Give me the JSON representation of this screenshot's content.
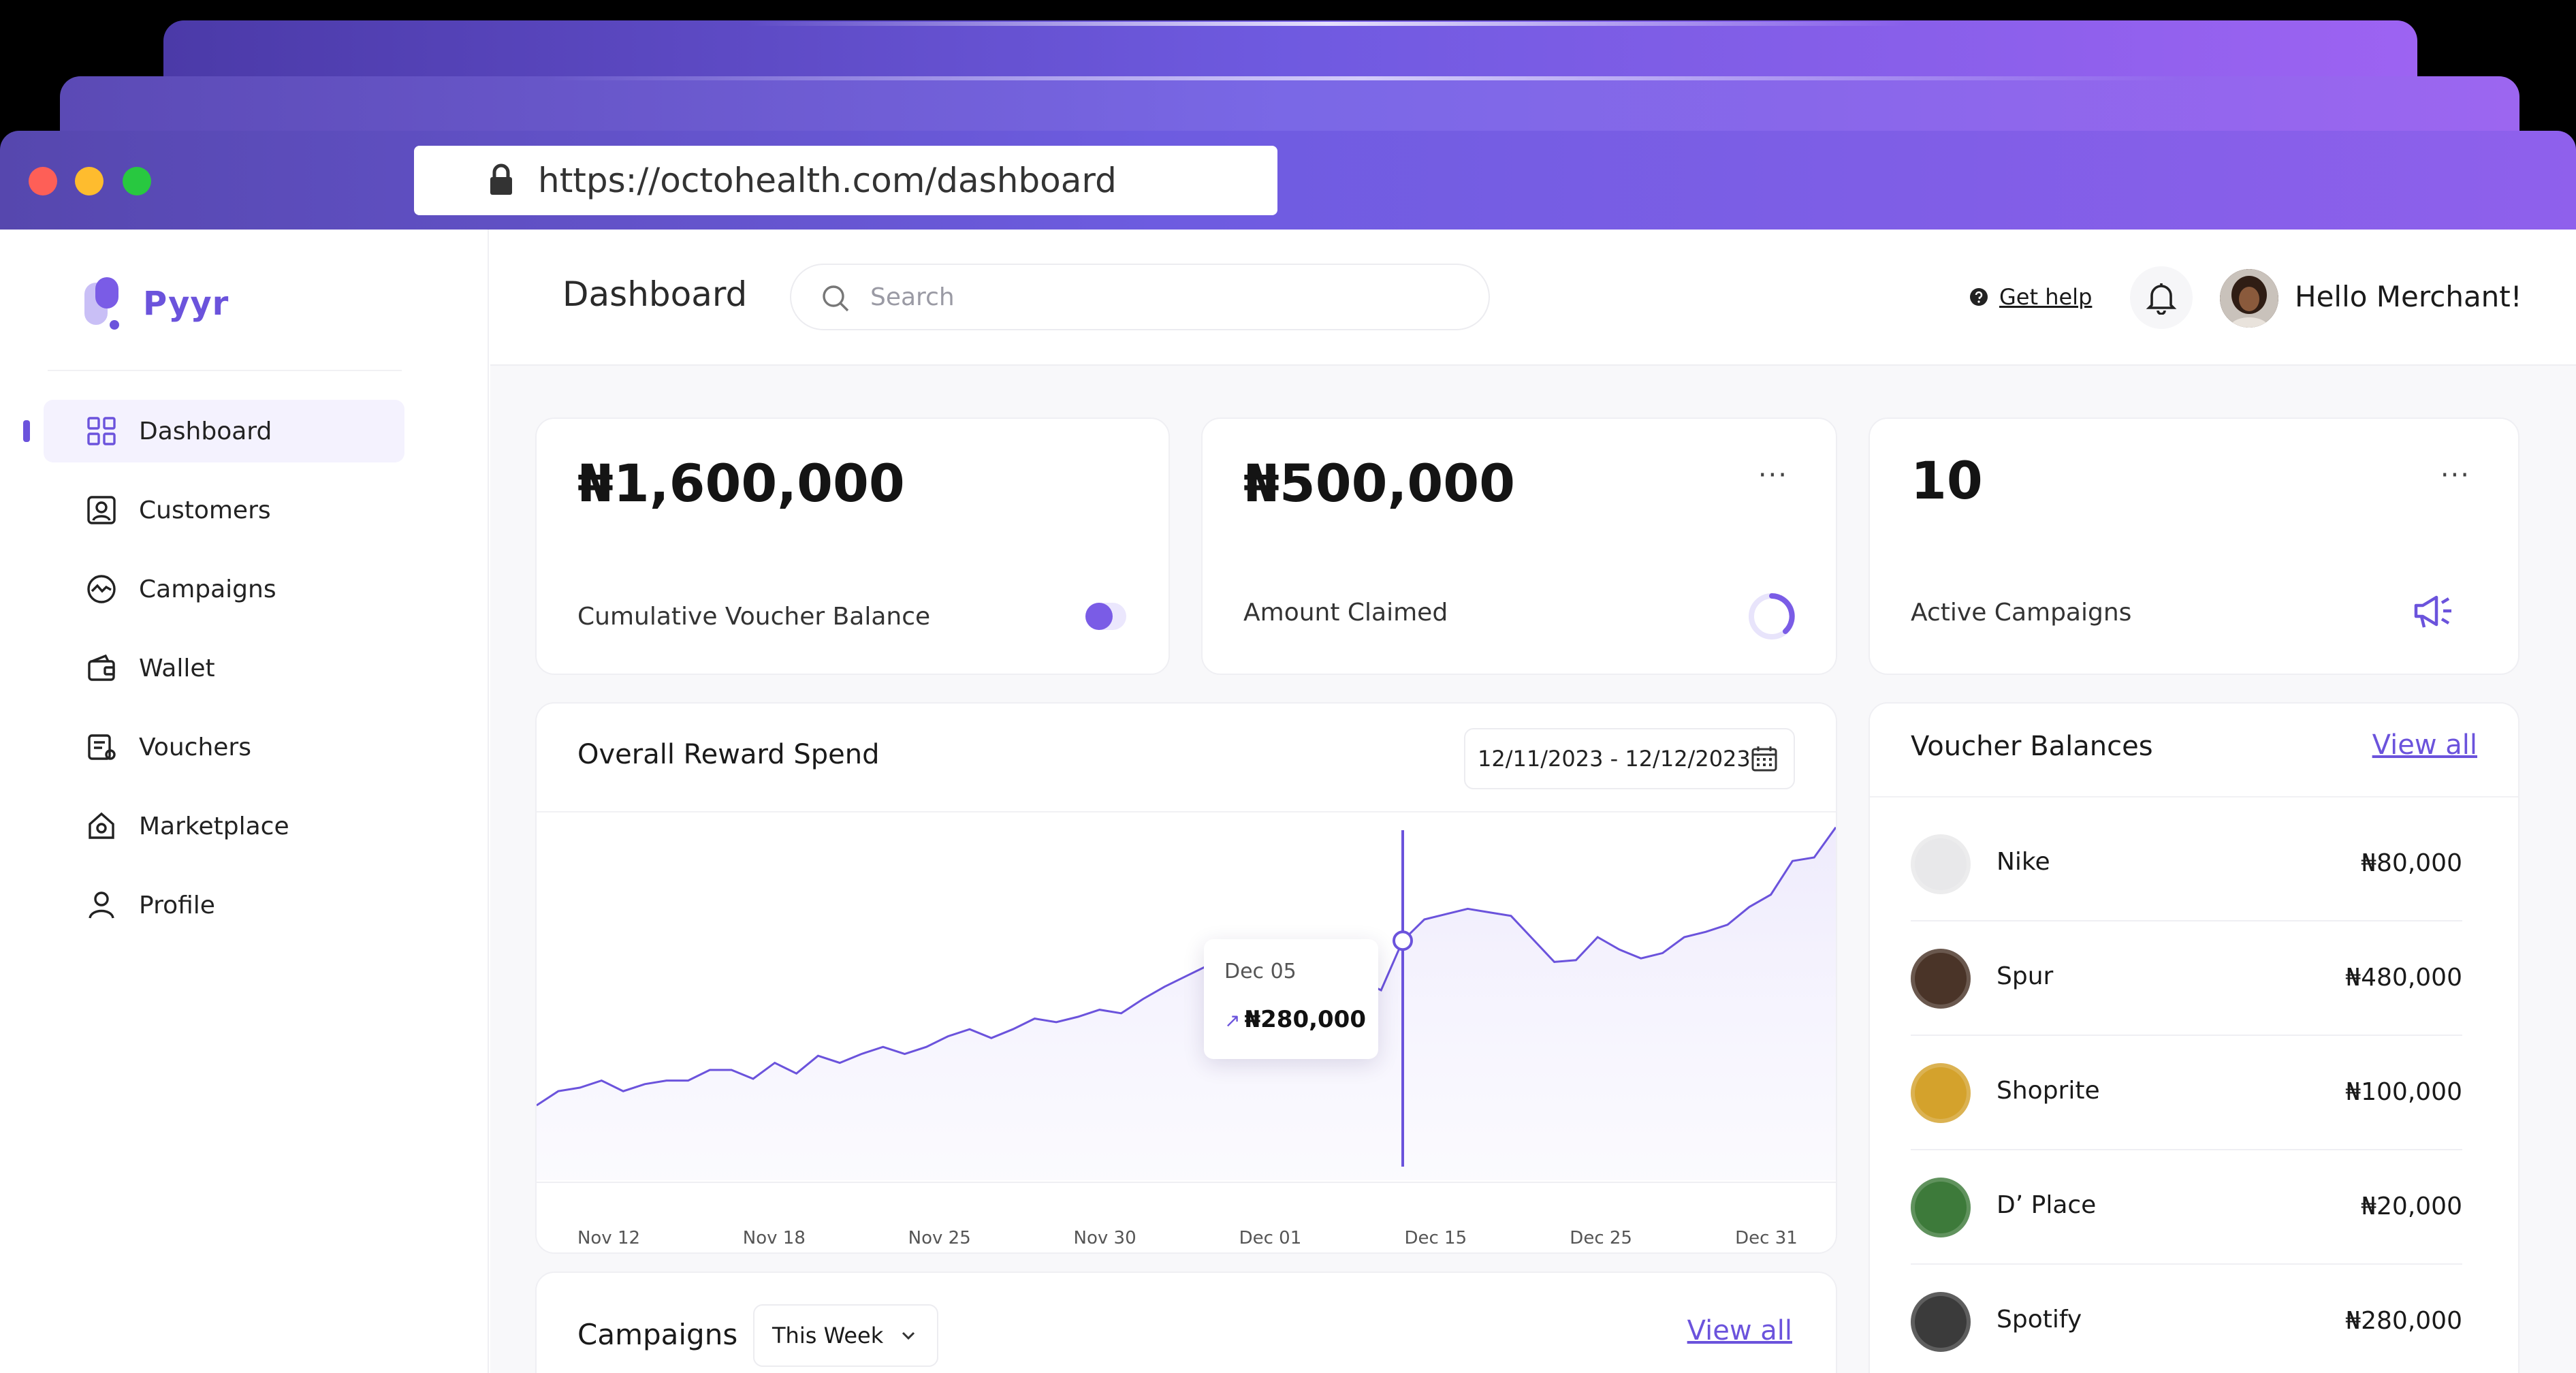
{
  "browser": {
    "url": "https://octohealth.com/dashboard"
  },
  "sidebar": {
    "brand": "Pyyr",
    "items": [
      {
        "label": "Dashboard",
        "icon": "grid-icon",
        "active": true
      },
      {
        "label": "Customers",
        "icon": "user-card-icon"
      },
      {
        "label": "Campaigns",
        "icon": "activity-icon"
      },
      {
        "label": "Wallet",
        "icon": "wallet-icon"
      },
      {
        "label": "Vouchers",
        "icon": "voucher-icon"
      },
      {
        "label": "Marketplace",
        "icon": "store-icon"
      },
      {
        "label": "Profile",
        "icon": "person-icon"
      }
    ]
  },
  "header": {
    "title": "Dashboard",
    "search_placeholder": "Search",
    "help_label": "Get help",
    "greeting": "Hello Merchant!"
  },
  "stats": [
    {
      "value": "₦1,600,000",
      "label": "Cumulative Voucher Balance"
    },
    {
      "value": "₦500,000",
      "label": "Amount Claimed"
    },
    {
      "value": "10",
      "label": "Active Campaigns"
    }
  ],
  "reward_chart": {
    "title": "Overall Reward Spend",
    "date_range": "12/11/2023 - 12/12/2023",
    "tooltip": {
      "date": "Dec 05",
      "value": "₦280,000"
    }
  },
  "chart_data": {
    "type": "area",
    "title": "Overall Reward Spend",
    "x_ticks": [
      "Nov 12",
      "Nov 18",
      "Nov 25",
      "Nov 30",
      "Dec 01",
      "Dec 15",
      "Dec 25",
      "Dec 31"
    ],
    "y_values": [
      0.12,
      0.2,
      0.22,
      0.26,
      0.2,
      0.24,
      0.26,
      0.26,
      0.32,
      0.32,
      0.27,
      0.36,
      0.3,
      0.4,
      0.36,
      0.41,
      0.45,
      0.41,
      0.45,
      0.51,
      0.55,
      0.5,
      0.55,
      0.61,
      0.59,
      0.62,
      0.66,
      0.64,
      0.72,
      0.79,
      0.85,
      0.91,
      0.95,
      1.0,
      0.99,
      1.03,
      0.96,
      0.93,
      0.83,
      0.77,
      1.05,
      1.17,
      1.2,
      1.23,
      1.21,
      1.19,
      1.06,
      0.93,
      0.94,
      1.07,
      1.0,
      0.95,
      0.98,
      1.07,
      1.1,
      1.14,
      1.24,
      1.31,
      1.5,
      1.52,
      1.69
    ],
    "highlight": {
      "label": "Dec 05",
      "value": "₦280,000"
    },
    "grid": false,
    "legend": "none"
  },
  "voucher_balances": {
    "title": "Voucher Balances",
    "view_all": "View all",
    "items": [
      {
        "name": "Nike",
        "amount": "₦80,000",
        "logo_color": "#e8e8ea"
      },
      {
        "name": "Spur",
        "amount": "₦480,000",
        "logo_color": "#4a3428"
      },
      {
        "name": "Shoprite",
        "amount": "₦100,000",
        "logo_color": "#d4a22c"
      },
      {
        "name": "D’ Place",
        "amount": "₦20,000",
        "logo_color": "#3d7a3a"
      },
      {
        "name": "Spotify",
        "amount": "₦280,000",
        "logo_color": "#3b3b3b"
      }
    ]
  },
  "campaigns": {
    "title": "Campaigns",
    "period": "This Week",
    "view_all": "View all"
  },
  "colors": {
    "accent": "#6b53dc",
    "chrome_start": "#5647ae",
    "chrome_end": "#8f60ec"
  }
}
